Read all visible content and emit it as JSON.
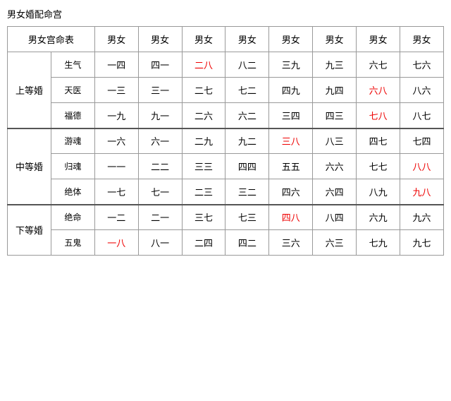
{
  "title": "男女婚配命宫",
  "table": {
    "header_row1": "男女宫命表",
    "columns": [
      "男女",
      "男女",
      "男女",
      "男女",
      "男女",
      "男女",
      "男女",
      "男女"
    ],
    "groups": [
      {
        "group_name": "上等婚",
        "rows": [
          {
            "sub_name": "生气",
            "cells": [
              {
                "text": "一四",
                "red": false
              },
              {
                "text": "四一",
                "red": false
              },
              {
                "text": "二八",
                "red": true
              },
              {
                "text": "八二",
                "red": false
              },
              {
                "text": "三九",
                "red": false
              },
              {
                "text": "九三",
                "red": false
              },
              {
                "text": "六七",
                "red": false
              },
              {
                "text": "七六",
                "red": false
              }
            ]
          },
          {
            "sub_name": "天医",
            "cells": [
              {
                "text": "一三",
                "red": false
              },
              {
                "text": "三一",
                "red": false
              },
              {
                "text": "二七",
                "red": false
              },
              {
                "text": "七二",
                "red": false
              },
              {
                "text": "四九",
                "red": false
              },
              {
                "text": "九四",
                "red": false
              },
              {
                "text": "六八",
                "red": true
              },
              {
                "text": "八六",
                "red": false
              }
            ]
          },
          {
            "sub_name": "福德",
            "cells": [
              {
                "text": "一九",
                "red": false
              },
              {
                "text": "九一",
                "red": false
              },
              {
                "text": "二六",
                "red": false
              },
              {
                "text": "六二",
                "red": false
              },
              {
                "text": "三四",
                "red": false
              },
              {
                "text": "四三",
                "red": false
              },
              {
                "text": "七八",
                "red": true
              },
              {
                "text": "八七",
                "red": false
              }
            ]
          }
        ]
      },
      {
        "group_name": "中等婚",
        "rows": [
          {
            "sub_name": "游魂",
            "cells": [
              {
                "text": "一六",
                "red": false
              },
              {
                "text": "六一",
                "red": false
              },
              {
                "text": "二九",
                "red": false
              },
              {
                "text": "九二",
                "red": false
              },
              {
                "text": "三八",
                "red": true
              },
              {
                "text": "八三",
                "red": false
              },
              {
                "text": "四七",
                "red": false
              },
              {
                "text": "七四",
                "red": false
              }
            ]
          },
          {
            "sub_name": "归魂",
            "cells": [
              {
                "text": "一一",
                "red": false
              },
              {
                "text": "二二",
                "red": false
              },
              {
                "text": "三三",
                "red": false
              },
              {
                "text": "四四",
                "red": false
              },
              {
                "text": "五五",
                "red": false
              },
              {
                "text": "六六",
                "red": false
              },
              {
                "text": "七七",
                "red": false
              },
              {
                "text": "八八",
                "red": true
              }
            ]
          },
          {
            "sub_name": "绝体",
            "cells": [
              {
                "text": "一七",
                "red": false
              },
              {
                "text": "七一",
                "red": false
              },
              {
                "text": "二三",
                "red": false
              },
              {
                "text": "三二",
                "red": false
              },
              {
                "text": "四六",
                "red": false
              },
              {
                "text": "六四",
                "red": false
              },
              {
                "text": "八九",
                "red": false
              },
              {
                "text": "九八",
                "red": true
              }
            ]
          }
        ]
      },
      {
        "group_name": "下等婚",
        "rows": [
          {
            "sub_name": "绝命",
            "cells": [
              {
                "text": "一二",
                "red": false
              },
              {
                "text": "二一",
                "red": false
              },
              {
                "text": "三七",
                "red": false
              },
              {
                "text": "七三",
                "red": false
              },
              {
                "text": "四八",
                "red": true
              },
              {
                "text": "八四",
                "red": false
              },
              {
                "text": "六九",
                "red": false
              },
              {
                "text": "九六",
                "red": false
              }
            ]
          },
          {
            "sub_name": "五鬼",
            "cells": [
              {
                "text": "一八",
                "red": true
              },
              {
                "text": "八一",
                "red": false
              },
              {
                "text": "二四",
                "red": false
              },
              {
                "text": "四二",
                "red": false
              },
              {
                "text": "三六",
                "red": false
              },
              {
                "text": "六三",
                "red": false
              },
              {
                "text": "七九",
                "red": false
              },
              {
                "text": "九七",
                "red": false
              }
            ]
          }
        ]
      }
    ]
  }
}
